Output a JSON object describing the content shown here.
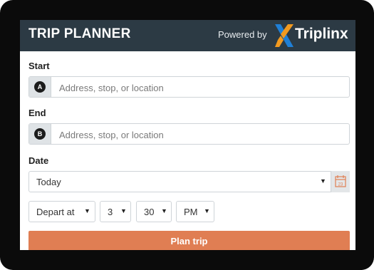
{
  "header": {
    "title": "TRIP PLANNER",
    "powered_by": "Powered by",
    "brand": "Triplinx"
  },
  "start": {
    "label": "Start",
    "badge": "A",
    "placeholder": "Address, stop, or location"
  },
  "end": {
    "label": "End",
    "badge": "B",
    "placeholder": "Address, stop, or location"
  },
  "date": {
    "label": "Date",
    "value": "Today",
    "calendar_day": "23",
    "calendar_icon": "calendar-icon"
  },
  "time": {
    "mode": "Depart at",
    "hour": "3",
    "minute": "30",
    "ampm": "PM"
  },
  "plan_button": "Plan trip",
  "colors": {
    "header_bg": "#2c3a44",
    "button_bg": "#e07e53",
    "logo_blue": "#1f7fd6",
    "logo_orange": "#f29a1f",
    "calendar_accent": "#e07e53"
  }
}
